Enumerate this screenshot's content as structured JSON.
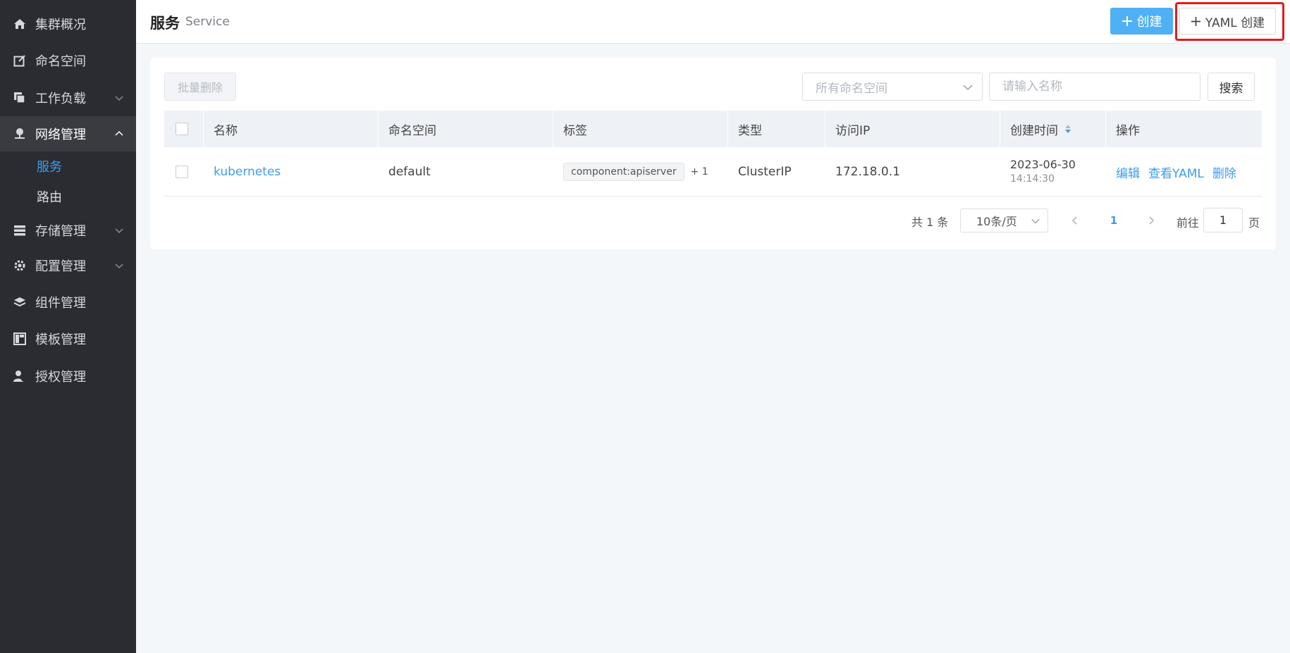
{
  "sidebar": {
    "items": [
      {
        "label": "集群概况",
        "icon": "home-icon"
      },
      {
        "label": "命名空间",
        "icon": "edit-icon"
      },
      {
        "label": "工作负载",
        "icon": "copy-icon"
      },
      {
        "label": "网络管理",
        "icon": "network-icon"
      },
      {
        "label": "存储管理",
        "icon": "storage-icon"
      },
      {
        "label": "配置管理",
        "icon": "gear-icon"
      },
      {
        "label": "组件管理",
        "icon": "layers-icon"
      },
      {
        "label": "模板管理",
        "icon": "template-icon"
      },
      {
        "label": "授权管理",
        "icon": "user-key-icon"
      }
    ],
    "network_sub": [
      {
        "label": "服务"
      },
      {
        "label": "路由"
      }
    ]
  },
  "header": {
    "title": "服务",
    "subtitle": "Service",
    "create_label": "创建",
    "yaml_create_label": "YAML 创建"
  },
  "toolbar": {
    "batch_delete_label": "批量删除",
    "namespace_select_placeholder": "所有命名空间",
    "name_input_placeholder": "请输入名称",
    "search_label": "搜索"
  },
  "table": {
    "columns": [
      "名称",
      "命名空间",
      "标签",
      "类型",
      "访问IP",
      "创建时间",
      "操作"
    ],
    "rows": [
      {
        "name": "kubernetes",
        "namespace": "default",
        "tag": "component:apiserver",
        "tag_more": "+ 1",
        "type": "ClusterIP",
        "ip": "172.18.0.1",
        "created_date": "2023-06-30",
        "created_time": "14:14:30",
        "actions": [
          "编辑",
          "查看YAML",
          "删除"
        ]
      }
    ]
  },
  "pagination": {
    "total_text": "共 1 条",
    "page_size": "10条/页",
    "current_page": "1",
    "goto_label": "前往",
    "goto_value": "1",
    "page_suffix": "页"
  },
  "colors": {
    "sidebar_bg": "#2b2c31",
    "accent": "#3c9cef",
    "create_button": "#4fb0f6",
    "highlight": "#e7191c"
  }
}
